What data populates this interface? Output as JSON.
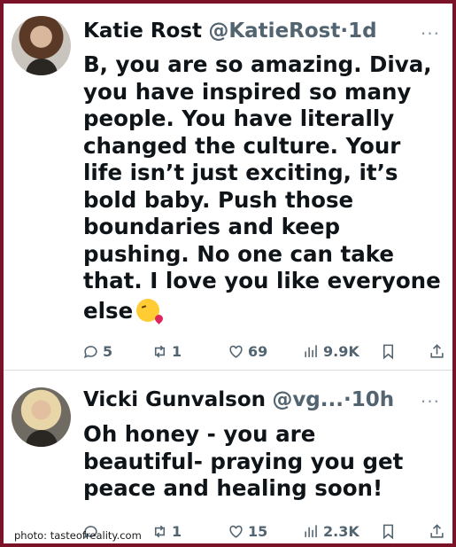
{
  "tweets": [
    {
      "name": "Katie Rost",
      "handle": "@KatieRost",
      "dot": "·",
      "time": "1d",
      "more": "···",
      "text": "B, you are so amazing. Diva, you have inspired so many people. You have literally changed the culture. Your life isn’t just exciting, it’s bold baby. Push those boundaries and keep pushing. No one can take that. I love you like everyone else",
      "emoji": "kissing-face-emoji",
      "replies": "5",
      "reposts": "1",
      "likes": "69",
      "views": "9.9K"
    },
    {
      "name": "Vicki Gunvalson",
      "handle": "@vg...",
      "dot": "·",
      "time": "10h",
      "more": "···",
      "text": "Oh honey - you are beautiful- praying you get peace and healing soon!",
      "replies": "",
      "reposts": "1",
      "likes": "15",
      "views": "2.3K"
    }
  ],
  "credit": "photo: tasteofreality.com",
  "colors": {
    "frame": "#7a1328",
    "text": "#0f1419",
    "muted": "#536471"
  }
}
